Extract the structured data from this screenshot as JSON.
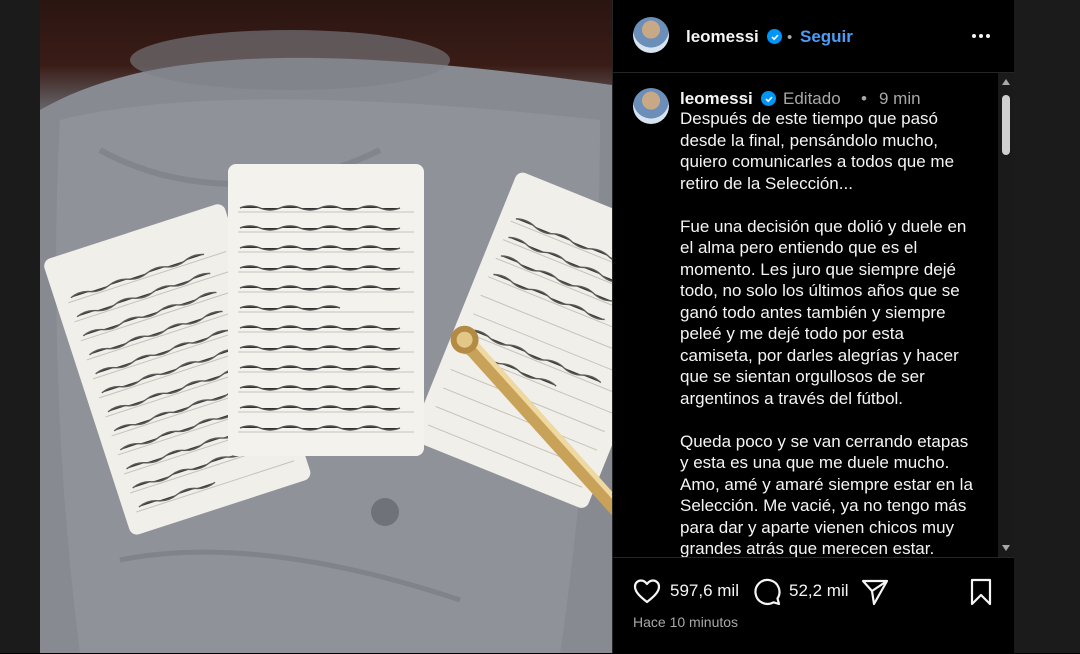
{
  "post": {
    "username": "leomessi",
    "follow_label": "Seguir",
    "edited_label": "Editado",
    "separator": "•",
    "age_short": "9 min",
    "caption_paragraphs": [
      "Después de este tiempo que pasó desde la final, pensándolo mucho, quiero comunicarles a todos que me retiro de la Selección...",
      "Fue una decisión que dolió y duele en el alma pero entiendo que es el momento. Les juro que siempre dejé todo, no solo los últimos años que se ganó todo antes también y siempre peleé y me dejé todo por esta camiseta, por darles alegrías y hacer que se sientan orgullosos de ser argentinos a través del fútbol.",
      "Queda poco y se van cerrando etapas y esta es una que me duele mucho. Amo, amé y amaré siempre estar en la Selección. Me vacié, ya no tengo más para dar y aparte vienen chicos muy grandes atrás que merecen estar."
    ],
    "likes_count": "597,6 mil",
    "comments_count": "52,2 mil",
    "timestamp": "Hace 10 minutos"
  },
  "icons": {
    "verified": "verified-badge-icon",
    "more": "more-options-icon",
    "like": "heart-icon",
    "comment": "comment-bubble-icon",
    "share": "send-icon",
    "save": "bookmark-icon"
  },
  "colors": {
    "background": "#000000",
    "text": "#f5f5f5",
    "muted": "#a8a8a8",
    "follow_blue": "#4a9df8",
    "verified_blue": "#0095f6"
  }
}
